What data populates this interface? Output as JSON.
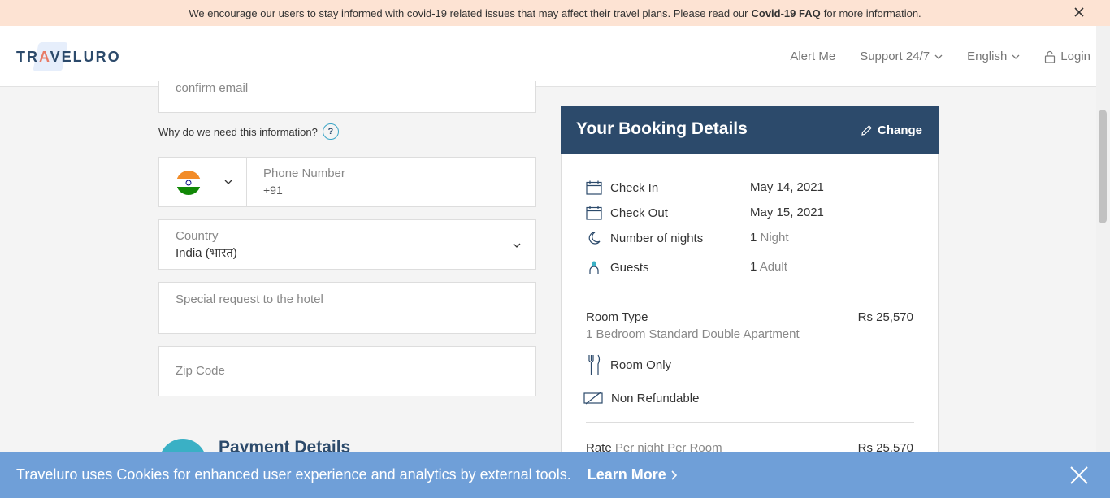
{
  "covid_banner": {
    "text_before": "We encourage our users to stay informed with covid-19 related issues that may affect their travel plans. Please read our",
    "link": "Covid-19 FAQ",
    "text_after": "for more information."
  },
  "header": {
    "logo_prefix": "TR",
    "logo_accent": "A",
    "logo_suffix": "VELURO",
    "nav": {
      "alert": "Alert Me",
      "support": "Support 24/7",
      "language": "English",
      "login": "Login"
    }
  },
  "form": {
    "confirm_email_placeholder": "confirm email",
    "why_info": "Why do we need this information?",
    "help_symbol": "?",
    "phone_label": "Phone Number",
    "phone_code": "+91",
    "country_label": "Country",
    "country_value": "India (भारत)",
    "special_request_placeholder": "Special request to the hotel",
    "zip_placeholder": "Zip Code",
    "payment_title": "Payment Details"
  },
  "booking": {
    "title": "Your Booking Details",
    "change": "Change",
    "check_in_label": "Check In",
    "check_in_value": "May 14, 2021",
    "check_out_label": "Check Out",
    "check_out_value": "May 15, 2021",
    "nights_label": "Number of nights",
    "nights_count": "1",
    "nights_unit": "Night",
    "guests_label": "Guests",
    "guests_count": "1",
    "guests_unit": "Adult",
    "room_type_label": "Room Type",
    "room_type_value": "1 Bedroom Standard Double Apartment",
    "room_price": "Rs 25,570",
    "meal": "Room Only",
    "refund": "Non Refundable",
    "rate_label": "Rate",
    "rate_sub": "Per night Per Room",
    "rate_price": "Rs 25,570"
  },
  "cookie": {
    "text": "Traveluro uses Cookies for enhanced user experience and analytics by external tools.",
    "learn_more": "Learn More"
  },
  "colors": {
    "navy": "#2c4a6b",
    "cookie_blue": "#6f9fd8",
    "covid_peach": "#fde3d3"
  }
}
